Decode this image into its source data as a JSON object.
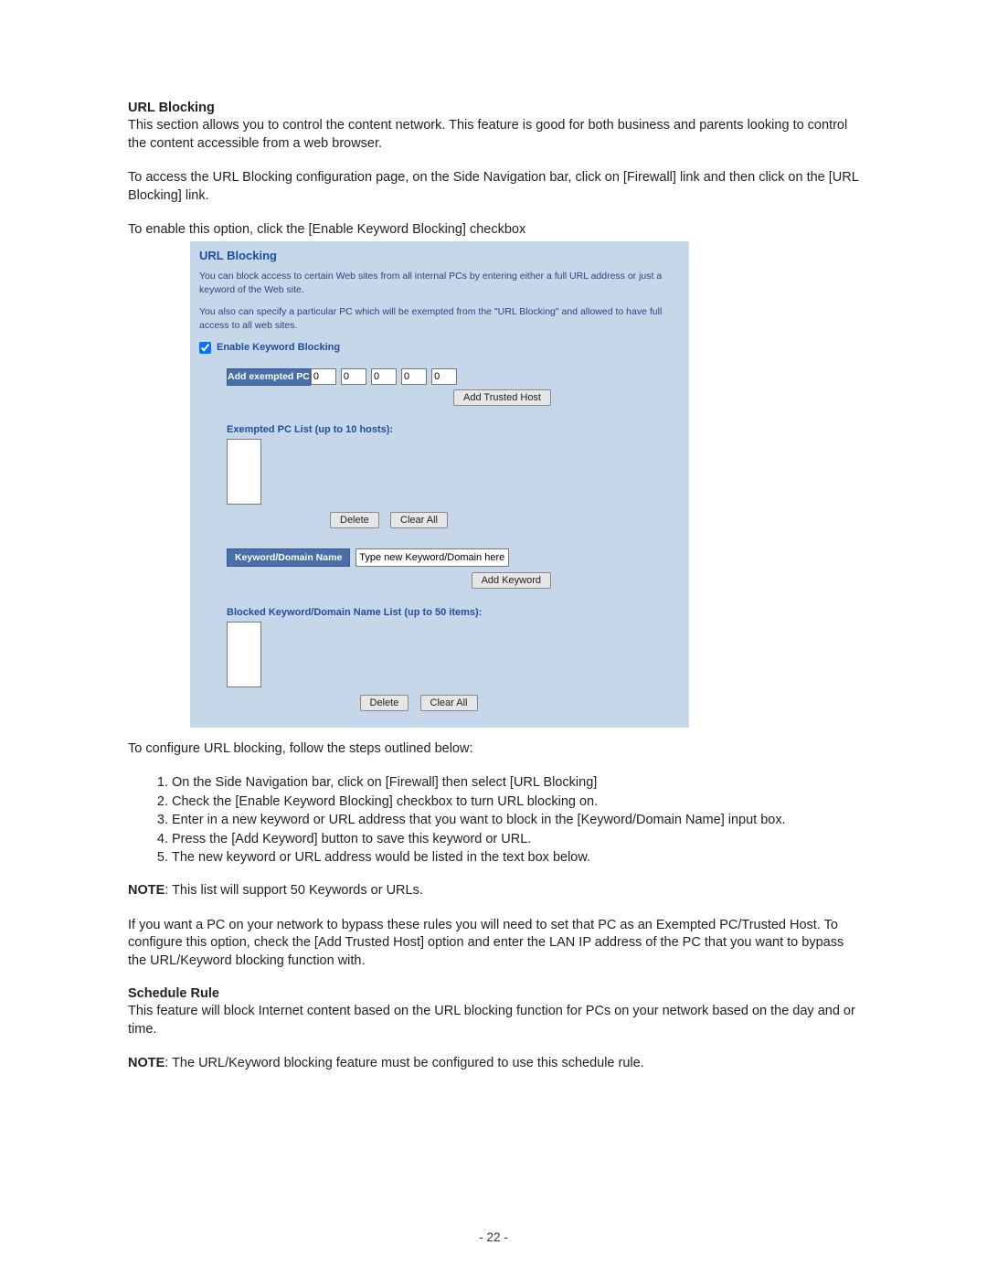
{
  "doc": {
    "section1_title": "URL Blocking",
    "intro1": "This section allows you to control the content network. This feature is good for both business and parents looking to control the content accessible from a web browser.",
    "intro2": "To access the URL Blocking configuration page, on the Side Navigation bar, click on [Firewall] link and then click on the [URL Blocking] link.",
    "intro3": "To enable this option, click the [Enable Keyword Blocking] checkbox",
    "after_panel": "To configure URL blocking, follow the steps outlined below:",
    "steps": [
      "On the Side Navigation bar, click on [Firewall] then select [URL Blocking]",
      "Check the [Enable Keyword Blocking] checkbox to turn URL blocking on.",
      "Enter in a new keyword or URL address that you want to block in the [Keyword/Domain Name] input box.",
      "Press the [Add Keyword] button to save this keyword or URL.",
      "The new keyword or URL address would be listed in the text box below."
    ],
    "note1_label": "NOTE",
    "note1_text": ": This list will support 50 Keywords or URLs.",
    "trusted_host_para": "If you want a PC on your network to bypass these rules you will need to set that PC as an Exempted PC/Trusted Host.  To configure this option, check the [Add Trusted Host] option and enter the LAN IP address of the PC that you want to bypass the URL/Keyword blocking function with.",
    "section2_title": "Schedule Rule",
    "schedule_para": "This feature will block Internet content based on the URL blocking function for PCs on your network based on the day and or time.",
    "note2_label": "NOTE",
    "note2_text": ": The URL/Keyword blocking feature must be configured to use this schedule rule.",
    "page_number": "- 22 -"
  },
  "panel": {
    "title": "URL Blocking",
    "desc1": "You can block access to certain Web sites from all internal PCs by entering either a full URL address or just a keyword of the Web site.",
    "desc2": "You also can specify a particular PC which will be exempted from the \"URL Blocking\" and allowed to have full access to all web sites.",
    "enable_label": "Enable Keyword Blocking",
    "add_exempted_label": "Add exempted PC",
    "ip": [
      "0",
      "0",
      "0",
      "0",
      "0"
    ],
    "add_trusted_btn": "Add Trusted Host",
    "exempted_list_label": "Exempted PC List (up to 10 hosts):",
    "delete_btn": "Delete",
    "clearall_btn": "Clear All",
    "keyword_field_label": "Keyword/Domain Name",
    "keyword_placeholder": "Type new Keyword/Domain here",
    "add_keyword_btn": "Add Keyword",
    "blocked_list_label": "Blocked Keyword/Domain Name List (up to 50 items):"
  }
}
